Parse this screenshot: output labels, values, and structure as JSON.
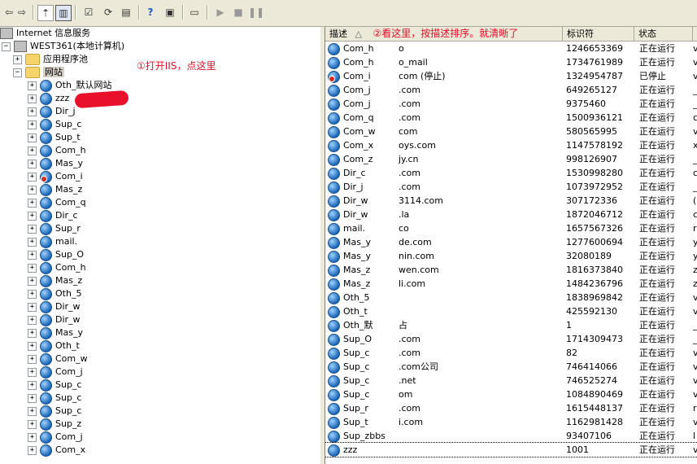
{
  "toolbar": {
    "buttons": [
      "back-icon",
      "forward-icon",
      "up-folder-icon",
      "show-hide-tree-icon",
      "properties-icon",
      "refresh-icon",
      "export-list-icon",
      "help-icon",
      "console-icon",
      "computer-icon",
      "play-icon",
      "stop-icon",
      "pause-icon"
    ]
  },
  "tree": {
    "root": "Internet 信息服务",
    "computer": "WEST361(本地计算机)",
    "app_pools": "应用程序池",
    "websites": "网站",
    "sites": [
      "Oth_默认网站",
      "zzz",
      "Dir_j",
      "Sup_c",
      "Sup_t",
      "Com_h",
      "Mas_y",
      "Com_i",
      "Mas_z",
      "Com_q",
      "Dir_c",
      "Sup_r",
      "mail.",
      "Sup_O",
      "Com_h",
      "Mas_z",
      "Oth_5",
      "Dir_w",
      "Dir_w",
      "Mas_y",
      "Oth_t",
      "Com_w",
      "Com_j",
      "Sup_c",
      "Sup_c",
      "Sup_c",
      "Sup_z",
      "Com_j",
      "Com_x"
    ]
  },
  "annotations": {
    "open_iis": "①打开IIS，点这里",
    "sort_hint": "②看这里，按描述排序。就清晰了"
  },
  "list": {
    "columns": [
      "描述",
      "标识符",
      "状态"
    ],
    "rows": [
      {
        "name": "Com_h",
        "desc": "o",
        "id": "1246653369",
        "status": "正在运行",
        "x": "v",
        "stopped": false
      },
      {
        "name": "Com_h",
        "desc": "o_mail",
        "id": "1734761989",
        "status": "正在运行",
        "x": "v",
        "stopped": false
      },
      {
        "name": "Com_i",
        "desc": "com (停止)",
        "id": "1324954787",
        "status": "已停止",
        "x": "v",
        "stopped": true
      },
      {
        "name": "Com_j",
        "desc": ".com",
        "id": "649265127",
        "status": "正在运行",
        "x": "_",
        "stopped": false
      },
      {
        "name": "Com_j",
        "desc": ".com",
        "id": "9375460",
        "status": "正在运行",
        "x": "_",
        "stopped": false
      },
      {
        "name": "Com_q",
        "desc": ".com",
        "id": "1500936121",
        "status": "正在运行",
        "x": "c",
        "stopped": false
      },
      {
        "name": "Com_w",
        "desc": "com",
        "id": "580565995",
        "status": "正在运行",
        "x": "v",
        "stopped": false
      },
      {
        "name": "Com_x",
        "desc": "oys.com",
        "id": "1147578192",
        "status": "正在运行",
        "x": "x",
        "stopped": false
      },
      {
        "name": "Com_z",
        "desc": "jy.cn",
        "id": "998126907",
        "status": "正在运行",
        "x": "_",
        "stopped": false
      },
      {
        "name": "Dir_c",
        "desc": ".com",
        "id": "1530998280",
        "status": "正在运行",
        "x": "c",
        "stopped": false
      },
      {
        "name": "Dir_j",
        "desc": ".com",
        "id": "1073972952",
        "status": "正在运行",
        "x": "_",
        "stopped": false
      },
      {
        "name": "Dir_w",
        "desc": "3114.com",
        "id": "307172336",
        "status": "正在运行",
        "x": "(",
        "stopped": false
      },
      {
        "name": "Dir_w",
        "desc": ".la",
        "id": "1872046712",
        "status": "正在运行",
        "x": "c",
        "stopped": false
      },
      {
        "name": "mail.",
        "desc": "co",
        "id": "1657567326",
        "status": "正在运行",
        "x": "r",
        "stopped": false
      },
      {
        "name": "Mas_y",
        "desc": "de.com",
        "id": "1277600694",
        "status": "正在运行",
        "x": "y",
        "stopped": false
      },
      {
        "name": "Mas_y",
        "desc": "nin.com",
        "id": "32080189",
        "status": "正在运行",
        "x": "y",
        "stopped": false
      },
      {
        "name": "Mas_z",
        "desc": "wen.com",
        "id": "1816373840",
        "status": "正在运行",
        "x": "z",
        "stopped": false
      },
      {
        "name": "Mas_z",
        "desc": "li.com",
        "id": "1484236796",
        "status": "正在运行",
        "x": "z",
        "stopped": false
      },
      {
        "name": "Oth_5",
        "desc": "",
        "id": "1838969842",
        "status": "正在运行",
        "x": "v",
        "stopped": false
      },
      {
        "name": "Oth_t",
        "desc": "",
        "id": "425592130",
        "status": "正在运行",
        "x": "v",
        "stopped": false
      },
      {
        "name": "Oth_默",
        "desc": "占",
        "id": "1",
        "status": "正在运行",
        "x": "_",
        "stopped": false
      },
      {
        "name": "Sup_O",
        "desc": ".com",
        "id": "1714309473",
        "status": "正在运行",
        "x": "_",
        "stopped": false
      },
      {
        "name": "Sup_c",
        "desc": ".com",
        "id": "82",
        "status": "正在运行",
        "x": "v",
        "stopped": false
      },
      {
        "name": "Sup_c",
        "desc": ".com公司",
        "id": "746414066",
        "status": "正在运行",
        "x": "v",
        "stopped": false
      },
      {
        "name": "Sup_c",
        "desc": ".net",
        "id": "746525274",
        "status": "正在运行",
        "x": "v",
        "stopped": false
      },
      {
        "name": "Sup_c",
        "desc": "om",
        "id": "1084890469",
        "status": "正在运行",
        "x": "v",
        "stopped": false
      },
      {
        "name": "Sup_r",
        "desc": ".com",
        "id": "1615448137",
        "status": "正在运行",
        "x": "r",
        "stopped": false
      },
      {
        "name": "Sup_t",
        "desc": "i.com",
        "id": "1162981428",
        "status": "正在运行",
        "x": "v",
        "stopped": false
      },
      {
        "name": "Sup_zbbs",
        "desc": "",
        "id": "93407106",
        "status": "正在运行",
        "x": "l",
        "stopped": false
      },
      {
        "name": "zzz",
        "desc": "",
        "id": "1001",
        "status": "正在运行",
        "x": "v",
        "stopped": false
      }
    ]
  }
}
